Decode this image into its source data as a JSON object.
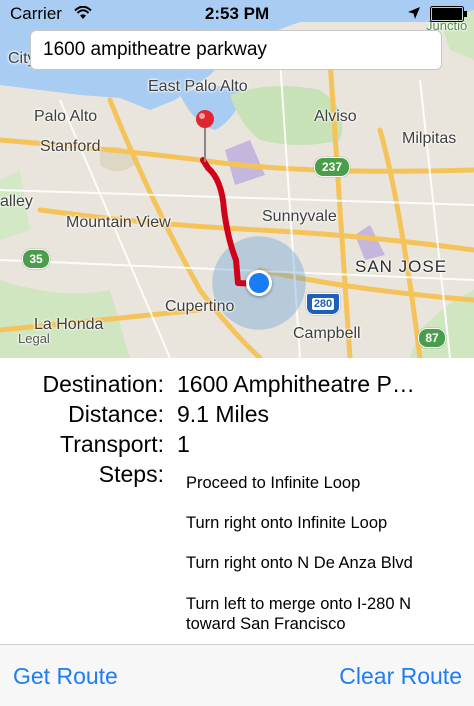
{
  "status_bar": {
    "carrier": "Carrier",
    "time": "2:53 PM",
    "icons": [
      "wifi-icon",
      "location-arrow-icon",
      "battery-icon"
    ]
  },
  "search": {
    "value": "1600 ampitheatre parkway"
  },
  "map": {
    "labels": {
      "city": "City",
      "east_palo_alto": "East Palo Alto",
      "palo_alto": "Palo Alto",
      "alviso": "Alviso",
      "milpitas": "Milpitas",
      "stanford": "Stanford",
      "mountain_view": "Mountain View",
      "sunnyvale": "Sunnyvale",
      "san_jose": "SAN JOSE",
      "cupertino": "Cupertino",
      "campbell": "Campbell",
      "la_honda": "La Honda",
      "legal": "Legal",
      "alley": "alley",
      "junction": "Junctio"
    },
    "shields": {
      "hwy_237": "237",
      "hwy_35": "35",
      "i_280": "280",
      "hwy_87": "87"
    },
    "colors": {
      "route": "#d0021b",
      "user_location": "#1a7cf5",
      "pin": "#e0262f"
    }
  },
  "details": {
    "destination_label": "Destination:",
    "destination_value": "1600 Amphitheatre P…",
    "distance_label": "Distance:",
    "distance_value": "9.1 Miles",
    "transport_label": "Transport:",
    "transport_value": "1",
    "steps_label": "Steps:",
    "steps": [
      "Proceed to Infinite Loop",
      "Turn right onto Infinite Loop",
      "Turn right onto N De Anza Blvd",
      "Turn left to merge onto I-280 N toward San Francisco"
    ]
  },
  "toolbar": {
    "get_route": "Get Route",
    "clear_route": "Clear Route",
    "accent": "#1f7cf2"
  }
}
